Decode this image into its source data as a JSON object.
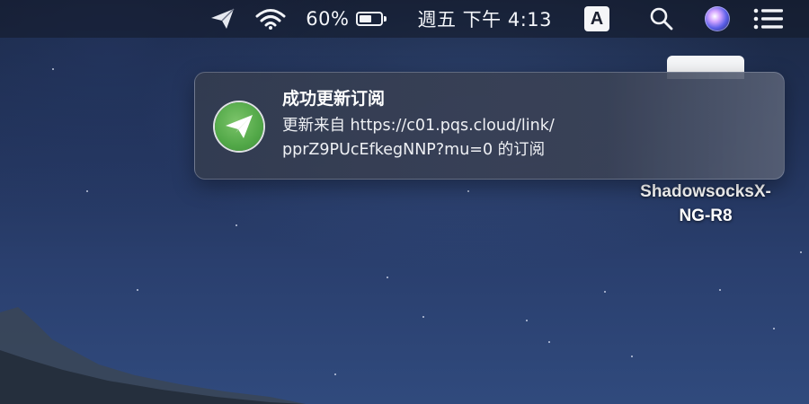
{
  "menubar": {
    "battery_percent_text": "60%",
    "battery_level": 0.6,
    "datetime": "週五 下午 4:13",
    "input_source": "A",
    "icons": [
      "shadowsocks-icon",
      "wifi-icon",
      "battery-icon",
      "search-icon",
      "siri-icon",
      "notification-center-icon"
    ]
  },
  "notification": {
    "title": "成功更新订阅",
    "body_line1": "更新来自 https://c01.pqs.cloud/link/",
    "body_line2": "pprZ9PUcEfkegNNP?mu=0 的订阅",
    "icon": "shadowsocks-app-icon",
    "accent_color": "#52a848"
  },
  "desktop": {
    "icon_label_line1": "ShadowsocksX-",
    "icon_label_line2": "NG-R8"
  }
}
